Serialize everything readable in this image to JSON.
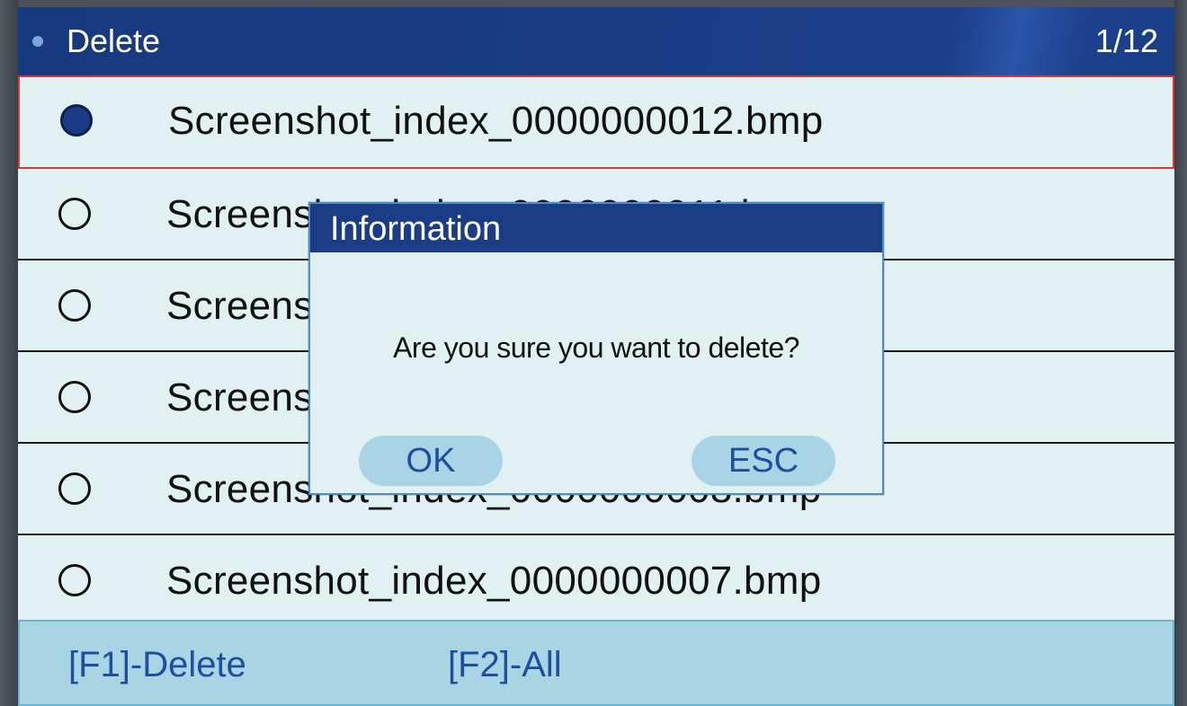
{
  "header": {
    "title": "Delete",
    "pager": "1/12"
  },
  "files": [
    {
      "name": "Screenshot_index_0000000012.bmp",
      "selected": true
    },
    {
      "name": "Screenshot_index_0000000011.bmp",
      "selected": false
    },
    {
      "name": "Screenshot_index_0000000010.bmp",
      "selected": false
    },
    {
      "name": "Screenshot_index_0000000009.bmp",
      "selected": false
    },
    {
      "name": "Screenshot_index_0000000008.bmp",
      "selected": false
    },
    {
      "name": "Screenshot_index_0000000007.bmp",
      "selected": false
    }
  ],
  "footer": {
    "f1_label": "[F1]-Delete",
    "f2_label": "[F2]-All"
  },
  "dialog": {
    "title": "Information",
    "message": "Are you sure you want to delete?",
    "ok_label": "OK",
    "esc_label": "ESC"
  },
  "colors": {
    "header_bg": "#1a3d86",
    "row_bg": "#e1f0f1",
    "selection_border": "#d83a3a",
    "footer_bg": "#a9d4e4",
    "accent_text": "#1d4f9c"
  }
}
